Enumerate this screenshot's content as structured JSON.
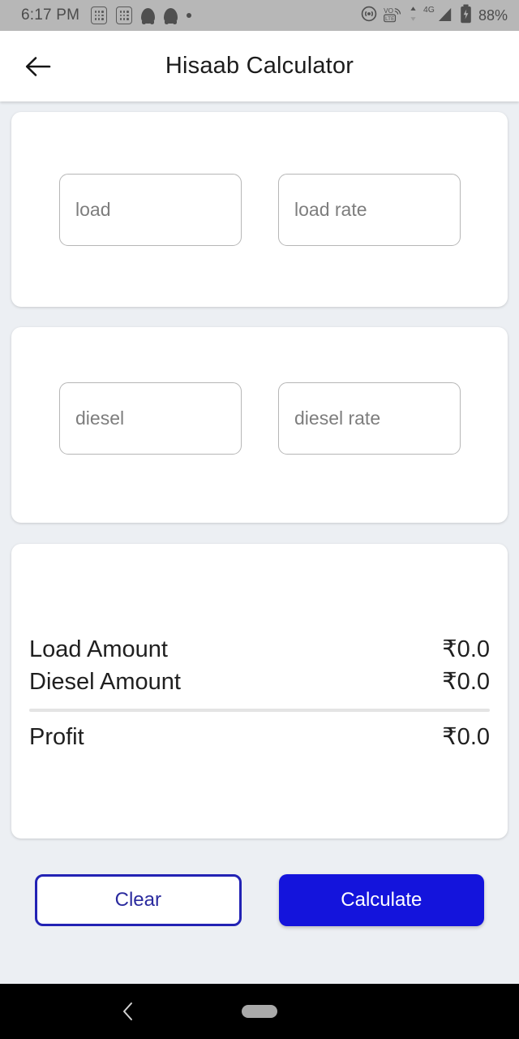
{
  "status_bar": {
    "time": "6:17 PM",
    "battery_percent": "88%",
    "left_icons": [
      "app-calculator-icon",
      "app-calculator-icon",
      "snapchat-icon",
      "snapchat-icon",
      "notification-dot-icon"
    ],
    "right_icons": [
      "hotspot-icon",
      "volte-icon",
      "data-transfer-icon",
      "4g-signal-icon",
      "battery-charging-icon"
    ],
    "network_type": "4G",
    "volte_label": "VO",
    "lte_label": "LTE",
    "background_color": "#b7b7b7"
  },
  "app_bar": {
    "title": "Hisaab Calculator",
    "back_icon": "back-arrow-icon"
  },
  "cards": {
    "load_card": {
      "fields": [
        {
          "name": "load",
          "placeholder": "load",
          "value": ""
        },
        {
          "name": "load_rate",
          "placeholder": "load rate",
          "value": ""
        }
      ]
    },
    "diesel_card": {
      "fields": [
        {
          "name": "diesel",
          "placeholder": "diesel",
          "value": ""
        },
        {
          "name": "diesel_rate",
          "placeholder": "diesel rate",
          "value": ""
        }
      ]
    },
    "results_card": {
      "rows": [
        {
          "label": "Load Amount",
          "value": "₹0.0"
        },
        {
          "label": "Diesel Amount",
          "value": "₹0.0"
        }
      ],
      "total": {
        "label": "Profit",
        "value": "₹0.0"
      }
    }
  },
  "actions": {
    "clear_label": "Clear",
    "calculate_label": "Calculate"
  },
  "nav_bar": {
    "back_icon": "nav-back-icon",
    "home_icon": "nav-home-pill-icon"
  },
  "colors": {
    "primary_blue": "#1414dc",
    "outline_blue": "#2222b4",
    "page_background": "#eceff3",
    "card_background": "#ffffff",
    "field_border": "#b6b6b6",
    "placeholder_text": "#7d7d7d"
  }
}
